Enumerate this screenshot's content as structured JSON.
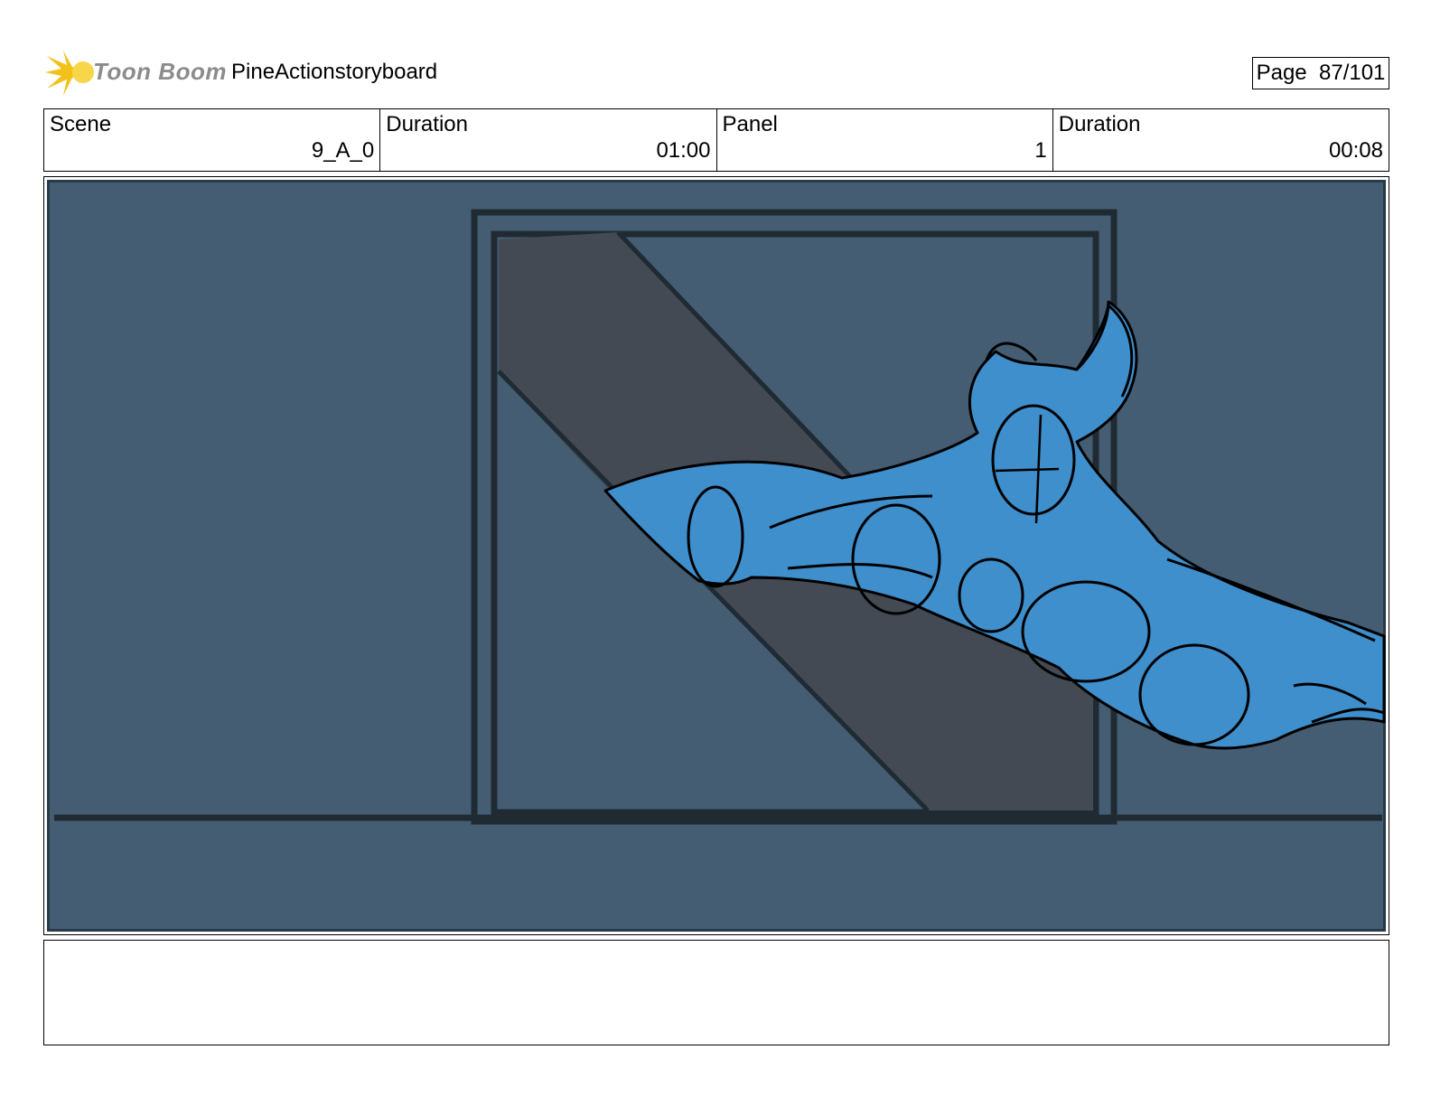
{
  "header": {
    "logo_text": "Toon Boom",
    "project_title": "PineActionstoryboard",
    "page_label": "Page",
    "page_number": "87/101"
  },
  "info": {
    "scene_label": "Scene",
    "scene_value": "9_A_0",
    "scene_duration_label": "Duration",
    "scene_duration_value": "01:00",
    "panel_label": "Panel",
    "panel_value": "1",
    "panel_duration_label": "Duration",
    "panel_duration_value": "00:08"
  },
  "colors": {
    "background_wall": "#445d72",
    "window_frame": "#1f2a33",
    "light_beam": "#434a54",
    "character_fill": "#3f8fcc",
    "outline": "#000000",
    "logo_star": "#f2c21b",
    "logo_text": "#8c8c8c"
  },
  "notes": {
    "text": ""
  }
}
